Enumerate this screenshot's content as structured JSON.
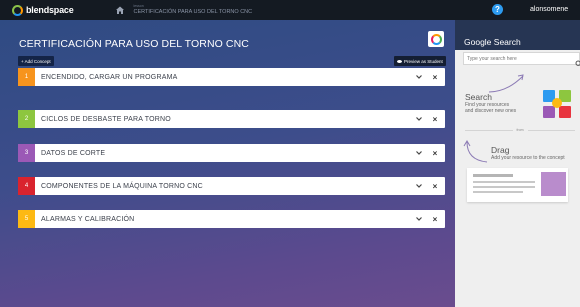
{
  "topbar": {
    "logo_text": "blendspace",
    "breadcrumb_sub": "lesson",
    "breadcrumb_title": "CERTIFICACIÓN PARA USO DEL TORNO CNC",
    "help_icon": "question-mark-icon",
    "username": "alonsomene"
  },
  "main": {
    "title": "CERTIFICACIÓN PARA USO DEL TORNO CNC",
    "add_concept_label": "+ Add Concept",
    "preview_label": "Preview as Student",
    "concepts": [
      {
        "number": "1",
        "label": "ENCENDIDO, CARGAR UN PROGRAMA",
        "color": "#f7941d"
      },
      {
        "number": "2",
        "label": "CICLOS DE DESBASTE PARA TORNO",
        "color": "#8dc63f"
      },
      {
        "number": "3",
        "label": "DATOS DE CORTE",
        "color": "#9b59b6"
      },
      {
        "number": "4",
        "label": "COMPONENTES DE LA MÁQUINA TORNO CNC",
        "color": "#d9232e"
      },
      {
        "number": "5",
        "label": "ALARMAS Y CALIBRACIÓN",
        "color": "#fdb913"
      }
    ],
    "close_glyph": "×"
  },
  "sidebar": {
    "title": "Google Search",
    "search_placeholder": "Type your search here",
    "search_hint_title": "Search",
    "search_hint_text": [
      "Find your resources",
      "and discover new ones"
    ],
    "divider_text": "from",
    "drag_hint_title": "Drag",
    "drag_hint_text": "Add your resource to the concept"
  }
}
